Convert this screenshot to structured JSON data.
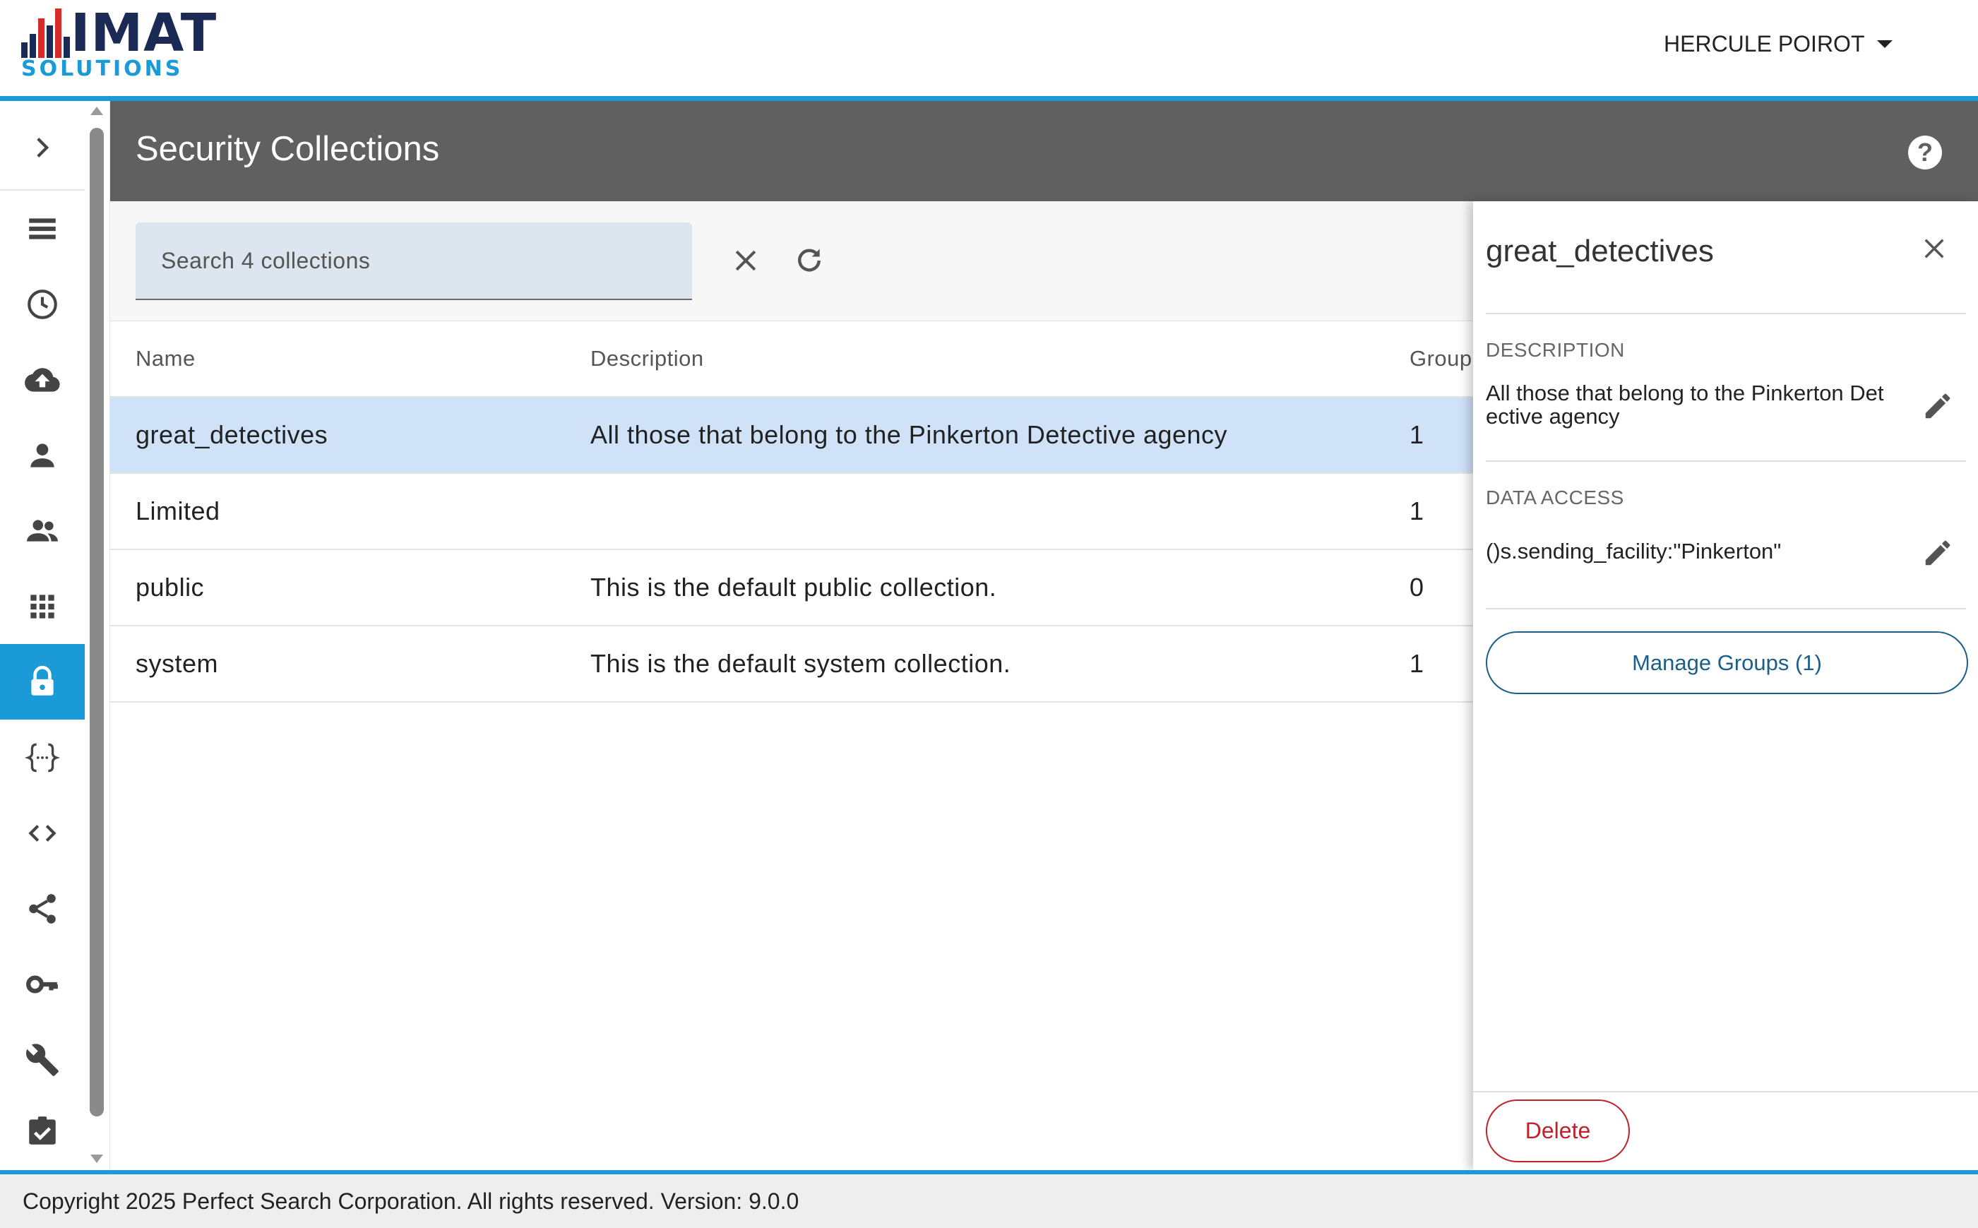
{
  "header": {
    "logo_main": "IMAT",
    "logo_sub": "SOLUTIONS",
    "user_name": "HERCULE POIROT"
  },
  "sidebar": {
    "items": [
      {
        "icon": "chevron-right-icon"
      },
      {
        "icon": "list-icon"
      },
      {
        "icon": "clock-icon"
      },
      {
        "icon": "cloud-upload-icon"
      },
      {
        "icon": "person-icon"
      },
      {
        "icon": "people-icon"
      },
      {
        "icon": "apps-grid-icon"
      },
      {
        "icon": "lock-icon",
        "active": true
      },
      {
        "icon": "json-braces-icon"
      },
      {
        "icon": "code-icon"
      },
      {
        "icon": "share-icon"
      },
      {
        "icon": "key-icon"
      },
      {
        "icon": "wrench-icon"
      },
      {
        "icon": "checkbox-icon"
      }
    ]
  },
  "page": {
    "title": "Security Collections"
  },
  "search": {
    "placeholder": "Search 4 collections",
    "value": ""
  },
  "table": {
    "columns": [
      "Name",
      "Description",
      "Group"
    ],
    "rows": [
      {
        "name": "great_detectives",
        "description": "All those that belong to the Pinkerton Detective agency",
        "groups": "1",
        "selected": true
      },
      {
        "name": "Limited",
        "description": "",
        "groups": "1"
      },
      {
        "name": "public",
        "description": "This is the default public collection.",
        "groups": "0"
      },
      {
        "name": "system",
        "description": "This is the default system collection.",
        "groups": "1"
      }
    ]
  },
  "panel": {
    "title": "great_detectives",
    "description_label": "DESCRIPTION",
    "description_value": "All those that belong to the Pinkerton Detective agency",
    "data_access_label": "DATA ACCESS",
    "data_access_value": "()s.sending_facility:\"Pinkerton\"",
    "manage_groups_label": "Manage Groups (1)",
    "delete_label": "Delete"
  },
  "footer": {
    "text": "Copyright 2025 Perfect Search Corporation. All rights reserved. Version: 9.0.0"
  },
  "colors": {
    "accent": "#1a9ad6",
    "header_band": "#606060",
    "selected_row": "#cfe2f8",
    "delete": "#c0222c",
    "logo_navy": "#1b2a55",
    "logo_red": "#d52b2b"
  }
}
